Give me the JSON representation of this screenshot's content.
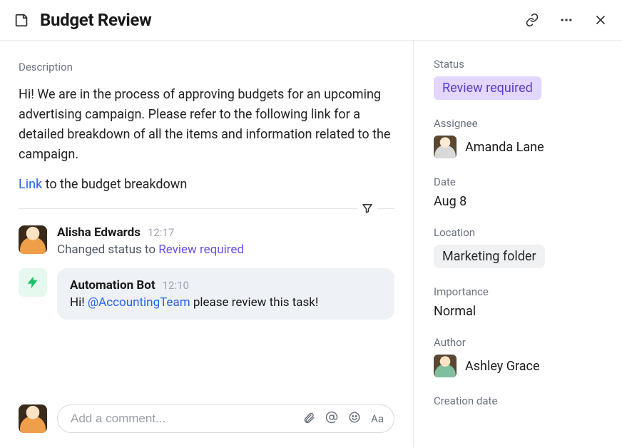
{
  "header": {
    "title": "Budget Review"
  },
  "main": {
    "description_label": "Description",
    "description_text": "Hi! We are in the process of approving budgets for an upcoming advertising campaign. Please refer to the following link for a detailed breakdown of all the items and information related to the campaign.",
    "link_word": "Link",
    "link_rest": " to the budget breakdown"
  },
  "activity": [
    {
      "actor": "Alisha Edwards",
      "time": "12:17",
      "desc_prefix": "Changed status to ",
      "desc_status": "Review required"
    },
    {
      "actor": "Automation Bot",
      "time": "12:10",
      "msg_prefix": "Hi! ",
      "mention": "@AccountingTeam",
      "msg_suffix": " please review this task!"
    }
  ],
  "composer": {
    "placeholder": "Add a comment...",
    "format_label": "Aa"
  },
  "sidebar": {
    "status_label": "Status",
    "status_value": "Review required",
    "assignee_label": "Assignee",
    "assignee_name": "Amanda Lane",
    "date_label": "Date",
    "date_value": "Aug 8",
    "location_label": "Location",
    "location_value": "Marketing folder",
    "importance_label": "Importance",
    "importance_value": "Normal",
    "author_label": "Author",
    "author_name": "Ashley Grace",
    "creation_label": "Creation date"
  }
}
